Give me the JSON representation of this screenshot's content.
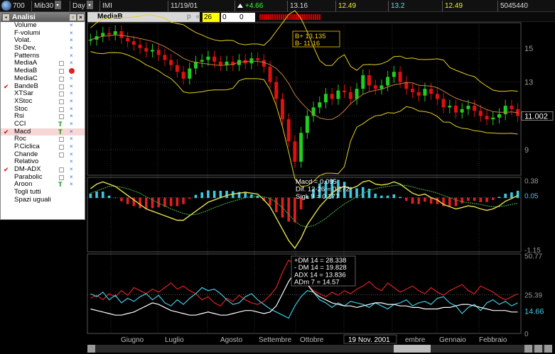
{
  "toolbar": {
    "symbol_code": "700",
    "market": "Mib30",
    "period": "Day",
    "instrument": "IMI",
    "date": "11/19/01",
    "change": "+4.66",
    "last": "13.16",
    "open": "12.49",
    "high": "13.2",
    "low": "12.49",
    "volume": "5045440"
  },
  "panel": {
    "title": "Analisi",
    "items": [
      {
        "label": "Volume",
        "checked": false,
        "marker": "x"
      },
      {
        "label": "F-volumi",
        "checked": false,
        "marker": "x"
      },
      {
        "label": "Volat.",
        "checked": false,
        "marker": "x"
      },
      {
        "label": "St-Dev.",
        "checked": false,
        "marker": "x"
      },
      {
        "label": "Patterns",
        "checked": false,
        "marker": "x"
      },
      {
        "label": "MediaA",
        "checked": false,
        "marker": "box-x"
      },
      {
        "label": "MediaB",
        "checked": false,
        "marker": "box-remove"
      },
      {
        "label": "MediaC",
        "checked": false,
        "marker": "box-x"
      },
      {
        "label": "BandeB",
        "checked": true,
        "marker": "box-x"
      },
      {
        "label": "XTSar",
        "checked": false,
        "marker": "box-x"
      },
      {
        "label": "XStoc",
        "checked": false,
        "marker": "box-x"
      },
      {
        "label": "Stoc",
        "checked": false,
        "marker": "box-x"
      },
      {
        "label": "Rsi",
        "checked": false,
        "marker": "box-x"
      },
      {
        "label": "CCI",
        "checked": false,
        "marker": "t"
      },
      {
        "label": "Macd",
        "checked": true,
        "marker": "t"
      },
      {
        "label": "Roc",
        "checked": false,
        "marker": "box-x"
      },
      {
        "label": "P.Ciclica",
        "checked": false,
        "marker": "box-x"
      },
      {
        "label": "Chande",
        "checked": false,
        "marker": "box-x"
      },
      {
        "label": "Relativo",
        "checked": false,
        "marker": "x"
      },
      {
        "label": "DM-ADX",
        "checked": true,
        "marker": "box-x"
      },
      {
        "label": "Parabolic",
        "checked": false,
        "marker": "box-x"
      },
      {
        "label": "Aroon",
        "checked": false,
        "marker": "t"
      },
      {
        "label": "Togli tutti",
        "checked": false,
        "marker": ""
      },
      {
        "label": "Spazi uguali",
        "checked": false,
        "marker": ""
      }
    ]
  },
  "chart_header": {
    "title": "MediaB",
    "nav_glyphs": "p « » ¤ ¤",
    "field1": "26",
    "field2": "0",
    "field3": "0"
  },
  "colors": {
    "up_candle": "#22cc22",
    "down_candle": "#e01010",
    "band": "#e8d020",
    "mid_line": "#c08040",
    "macd_line": "#e8e050",
    "signal_line": "#40a040",
    "hist_pos": "#40c8e0",
    "hist_neg": "#e02020",
    "plus_dm": "#e02020",
    "minus_dm": "#40c8e0",
    "adx": "#ffffff",
    "grid": "#303030"
  },
  "chart_data": [
    {
      "type": "candlestick",
      "panel": "price",
      "x_labels": [
        "Giugno",
        "Luglio",
        "Agosto",
        "Settembre",
        "Ottobre",
        "19 Nov. 2001",
        "embre",
        "Gennaio",
        "Febbraio"
      ],
      "y_ticks": [
        15.0,
        13.0,
        11.002,
        9.0
      ],
      "current_value": "11.002",
      "ylim": [
        7.5,
        16.5
      ],
      "annotations": [
        "B+ 13.135",
        "B- 11.16"
      ],
      "close_series": [
        15.5,
        15.7,
        15.9,
        15.8,
        16.0,
        15.6,
        15.4,
        15.2,
        15.0,
        14.8,
        14.9,
        14.6,
        14.3,
        14.0,
        13.6,
        13.2,
        13.8,
        14.2,
        14.3,
        14.5,
        14.2,
        14.0,
        14.2,
        14.0,
        14.3,
        14.1,
        14.4,
        14.3,
        13.9,
        13.0,
        12.0,
        10.8,
        9.5,
        8.3,
        10.0,
        11.0,
        11.5,
        11.8,
        12.3,
        12.0,
        12.5,
        12.4,
        12.0,
        12.6,
        13.4,
        12.8,
        12.6,
        12.8,
        13.3,
        13.6,
        13.0,
        12.6,
        12.4,
        12.2,
        12.6,
        12.3,
        12.0,
        11.5,
        11.6,
        11.2,
        11.4,
        11.6,
        11.3,
        11.0,
        10.8,
        10.9,
        11.1,
        11.6,
        11.4,
        11.0
      ]
    },
    {
      "type": "macd",
      "panel": "macd",
      "labels": [
        "Macd  = 0.095",
        "Dif. 12-26 = 0.272",
        "SigL 9 = 0.177"
      ],
      "y_ticks": [
        0.38,
        0.05,
        -1.15
      ],
      "current_value": "0.05",
      "ylim": [
        -1.2,
        0.45
      ],
      "macd_series": [
        0.2,
        0.3,
        0.35,
        0.3,
        0.25,
        0.15,
        0.05,
        -0.05,
        -0.15,
        -0.25,
        -0.3,
        -0.35,
        -0.4,
        -0.45,
        -0.5,
        -0.5,
        -0.4,
        -0.3,
        -0.2,
        -0.1,
        -0.05,
        0.0,
        0.05,
        0.08,
        0.1,
        0.12,
        0.1,
        0.08,
        -0.05,
        -0.2,
        -0.45,
        -0.7,
        -0.95,
        -1.12,
        -0.9,
        -0.6,
        -0.4,
        -0.2,
        -0.05,
        0.1,
        0.2,
        0.25,
        0.2,
        0.25,
        0.35,
        0.38,
        0.3,
        0.28,
        0.3,
        0.35,
        0.3,
        0.2,
        0.1,
        0.05,
        0.08,
        0.0,
        -0.05,
        -0.15,
        -0.2,
        -0.25,
        -0.22,
        -0.18,
        -0.2,
        -0.25,
        -0.28,
        -0.25,
        -0.18,
        -0.08,
        -0.02,
        0.05
      ],
      "signal_series": [
        0.1,
        0.15,
        0.2,
        0.25,
        0.25,
        0.23,
        0.2,
        0.15,
        0.1,
        0.02,
        -0.05,
        -0.12,
        -0.18,
        -0.25,
        -0.3,
        -0.35,
        -0.38,
        -0.37,
        -0.33,
        -0.28,
        -0.22,
        -0.17,
        -0.12,
        -0.08,
        -0.04,
        0.0,
        0.02,
        0.03,
        0.02,
        -0.02,
        -0.1,
        -0.22,
        -0.37,
        -0.52,
        -0.62,
        -0.65,
        -0.62,
        -0.55,
        -0.46,
        -0.35,
        -0.24,
        -0.14,
        -0.06,
        0.02,
        0.09,
        0.16,
        0.2,
        0.23,
        0.25,
        0.27,
        0.28,
        0.27,
        0.24,
        0.2,
        0.17,
        0.14,
        0.1,
        0.05,
        0.0,
        -0.05,
        -0.09,
        -0.11,
        -0.13,
        -0.15,
        -0.18,
        -0.2,
        -0.2,
        -0.18,
        -0.15,
        -0.12
      ]
    },
    {
      "type": "line",
      "panel": "dmi",
      "labels": [
        "+DM 14 = 28.338",
        "- DM 14 = 19.828",
        "ADX 14 = 13.836",
        "ADm 7 = 14.57"
      ],
      "y_ticks": [
        50.77,
        25.39,
        14.66,
        0
      ],
      "ylim": [
        0,
        52
      ],
      "series": [
        {
          "name": "+DM 14",
          "values": [
            23,
            25,
            22,
            26,
            24,
            28,
            25,
            30,
            28,
            26,
            29,
            27,
            30,
            33,
            29,
            31,
            28,
            26,
            22,
            24,
            20,
            18,
            23,
            21,
            25,
            22,
            20,
            19,
            21,
            25,
            30,
            40,
            48,
            45,
            38,
            32,
            28,
            26,
            24,
            27,
            25,
            28,
            26,
            29,
            31,
            34,
            30,
            28,
            33,
            30,
            27,
            29,
            31,
            28,
            26,
            30,
            27,
            25,
            28,
            30,
            32,
            28,
            26,
            31,
            29,
            27,
            24,
            22,
            24,
            26
          ]
        },
        {
          "name": "- DM 14",
          "values": [
            26,
            24,
            27,
            22,
            25,
            20,
            23,
            21,
            24,
            26,
            22,
            25,
            20,
            18,
            22,
            19,
            23,
            26,
            30,
            28,
            29,
            26,
            22,
            19,
            20,
            24,
            26,
            22,
            19,
            16,
            14,
            12,
            10,
            18,
            24,
            28,
            27,
            22,
            20,
            17,
            20,
            18,
            21,
            20,
            19,
            17,
            20,
            18,
            16,
            19,
            20,
            22,
            18,
            20,
            21,
            19,
            23,
            24,
            20,
            18,
            13,
            17,
            19,
            15,
            20,
            22,
            19,
            21,
            18,
            20
          ]
        },
        {
          "name": "ADX 14",
          "values": [
            16,
            15,
            14,
            13,
            12,
            12,
            13,
            14,
            16,
            18,
            20,
            19,
            17,
            15,
            14,
            13,
            12,
            12,
            13,
            14,
            13,
            12,
            12,
            13,
            14,
            15,
            15,
            14,
            13,
            14,
            18,
            26,
            34,
            40,
            38,
            32,
            27,
            24,
            22,
            20,
            19,
            18,
            18,
            17,
            18,
            19,
            20,
            20,
            19,
            19,
            18,
            18,
            17,
            17,
            16,
            16,
            16,
            17,
            17,
            18,
            19,
            19,
            18,
            17,
            16,
            15,
            15,
            15,
            14,
            14
          ]
        }
      ]
    }
  ]
}
